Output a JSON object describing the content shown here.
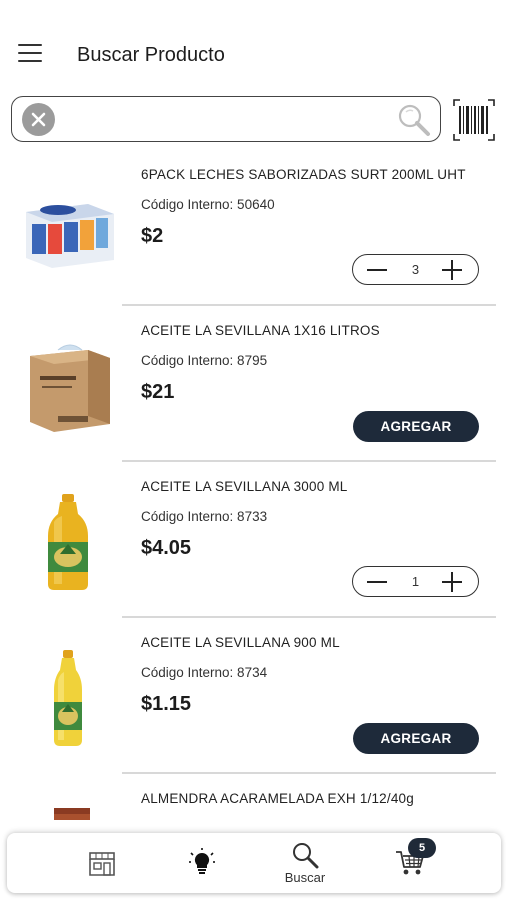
{
  "header": {
    "title": "Buscar Producto"
  },
  "search": {
    "value": "",
    "placeholder": ""
  },
  "products": [
    {
      "name": "6PACK LECHES SABORIZADAS SURT 200ML UHT",
      "code": "Código Interno: 50640",
      "price": "$2",
      "quantity": "3",
      "in_cart": true
    },
    {
      "name": "ACEITE LA SEVILLANA 1X16 LITROS",
      "code": "Código Interno: 8795",
      "price": "$21",
      "add_label": "AGREGAR",
      "in_cart": false
    },
    {
      "name": "ACEITE LA SEVILLANA 3000 ML",
      "code": "Código Interno: 8733",
      "price": "$4.05",
      "quantity": "1",
      "in_cart": true
    },
    {
      "name": "ACEITE LA SEVILLANA 900 ML",
      "code": "Código Interno: 8734",
      "price": "$1.15",
      "add_label": "AGREGAR",
      "in_cart": false
    },
    {
      "name": "ALMENDRA ACARAMELADA EXH 1/12/40g"
    }
  ],
  "bottom_nav": {
    "store_icon": "store-icon",
    "ideas_icon": "lightbulb-icon",
    "search_label": "Buscar",
    "cart_icon": "cart-icon",
    "cart_count": "5"
  },
  "colors": {
    "accent": "#1e2a3a",
    "clear_button": "#9b9b9b"
  }
}
